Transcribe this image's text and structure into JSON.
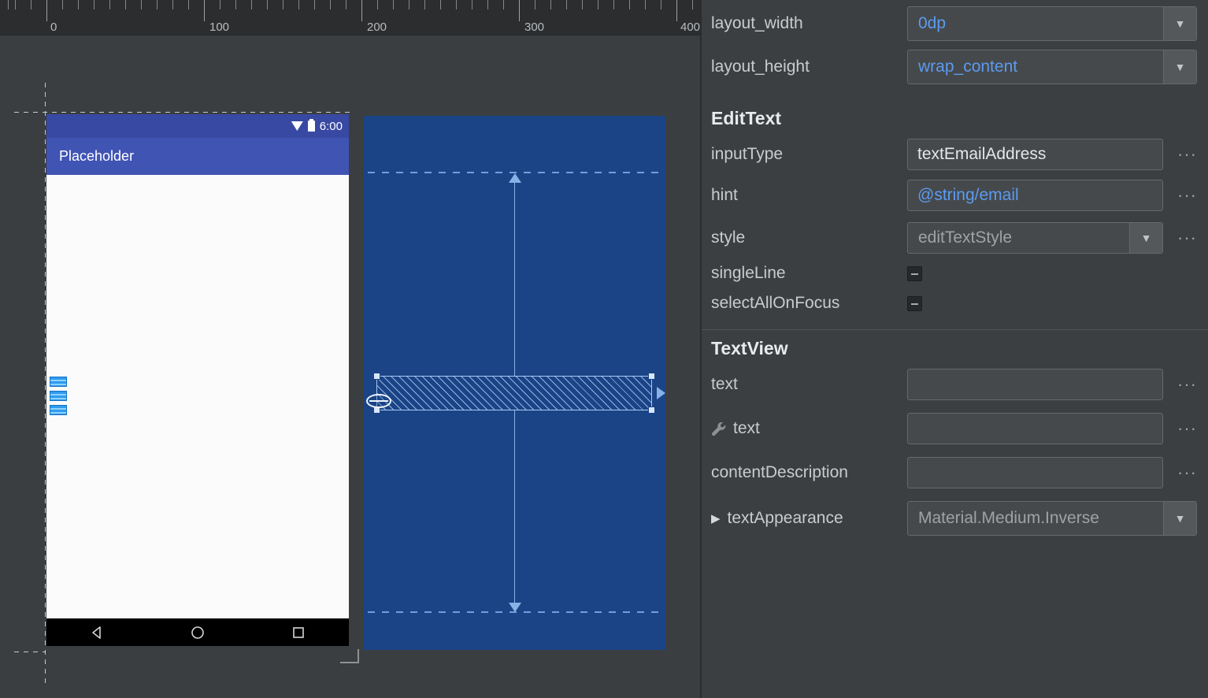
{
  "canvas": {
    "ruler_labels": [
      "0",
      "100",
      "200",
      "300",
      "400"
    ],
    "device": {
      "status_time": "6:00",
      "app_title": "Placeholder"
    }
  },
  "panel": {
    "sections": {
      "edittext": "EditText",
      "textview": "TextView"
    },
    "rows": {
      "layout_width": {
        "label": "layout_width",
        "value": "0dp"
      },
      "layout_height": {
        "label": "layout_height",
        "value": "wrap_content"
      },
      "inputType": {
        "label": "inputType",
        "value": "textEmailAddress"
      },
      "hint": {
        "label": "hint",
        "value": "@string/email"
      },
      "style": {
        "label": "style",
        "value": "editTextStyle"
      },
      "singleLine": {
        "label": "singleLine"
      },
      "selectAllOnFocus": {
        "label": "selectAllOnFocus"
      },
      "text": {
        "label": "text",
        "value": ""
      },
      "text_tools": {
        "label": "text",
        "value": ""
      },
      "contentDescription": {
        "label": "contentDescription",
        "value": ""
      },
      "textAppearance": {
        "label": "textAppearance",
        "value": "Material.Medium.Inverse"
      }
    },
    "icons": {
      "dropdown": "▼",
      "expander": "▶",
      "more": "···"
    }
  },
  "colors": {
    "value_accent": "#5b9bf1",
    "blueprint_background": "#1b4486",
    "appbar_blue": "#4054b4",
    "statusbar_blue": "#3849a3",
    "selection_blue": "#2e9bf0",
    "panel_background": "#3c3f41"
  }
}
